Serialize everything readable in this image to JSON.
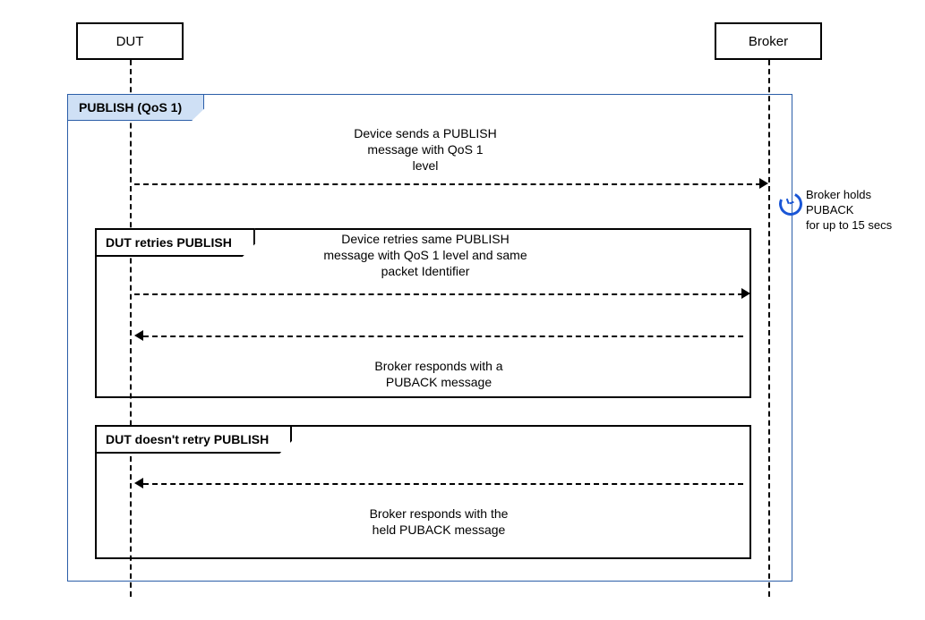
{
  "actors": {
    "dut": "DUT",
    "broker": "Broker"
  },
  "outer_frame_title": "PUBLISH (QoS 1)",
  "msg1": "Device sends a PUBLISH\nmessage with QoS 1\nlevel",
  "hold_note": "Broker holds PUBACK\nfor up to 15 secs",
  "loop1": {
    "title": "DUT retries PUBLISH",
    "msg_top": "Device retries same PUBLISH\nmessage with QoS 1 level and same\npacket Identifier",
    "msg_bottom": "Broker responds with a\nPUBACK message"
  },
  "loop2": {
    "title": "DUT doesn't retry PUBLISH",
    "msg": "Broker responds with the\nheld PUBACK message"
  }
}
